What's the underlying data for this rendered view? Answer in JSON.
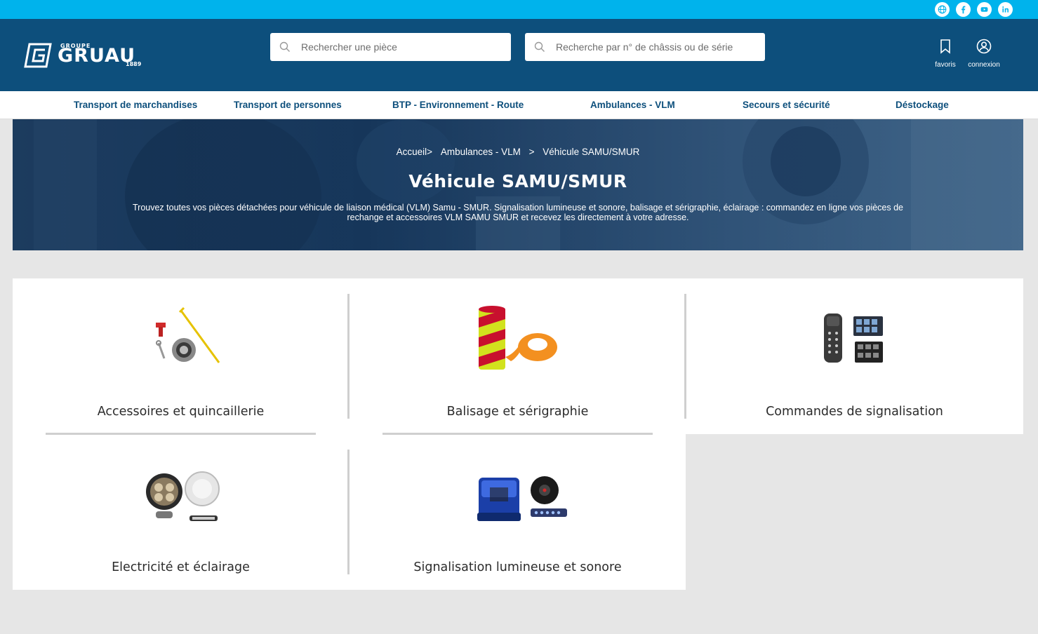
{
  "brand": {
    "small": "GROUPE",
    "name": "GRUAU",
    "year": "1889"
  },
  "colors": {
    "topbar": "#00b3ec",
    "header": "#0d4f7c",
    "nav_text": "#0d4f7c"
  },
  "social": [
    {
      "icon": "globe-icon"
    },
    {
      "icon": "facebook-icon"
    },
    {
      "icon": "youtube-icon"
    },
    {
      "icon": "linkedin-icon"
    }
  ],
  "search": {
    "part_placeholder": "Rechercher une pièce",
    "chassis_placeholder": "Recherche par n° de châssis ou de série"
  },
  "header_actions": {
    "favorites": "favoris",
    "login": "connexion"
  },
  "nav": [
    "Transport de marchandises",
    "Transport de personnes",
    "BTP - Environnement - Route",
    "Ambulances - VLM",
    "Secours et sécurité",
    "Déstockage"
  ],
  "breadcrumb": {
    "home": "Accueil>",
    "category": "Ambulances - VLM",
    "sep": ">",
    "current": "Véhicule SAMU/SMUR"
  },
  "hero": {
    "title": "Véhicule SAMU/SMUR",
    "description": "Trouvez toutes vos pièces détachées pour véhicule de liaison médical (VLM) Samu - SMUR. Signalisation lumineuse et sonore, balisage et sérigraphie, éclairage : commandez en ligne vos pièces de rechange et accessoires VLM SAMU SMUR et recevez les directement à votre adresse."
  },
  "categories": [
    {
      "label": "Accessoires et quincaillerie"
    },
    {
      "label": "Balisage et sérigraphie"
    },
    {
      "label": "Commandes de signalisation"
    },
    {
      "label": "Electricité et éclairage"
    },
    {
      "label": "Signalisation lumineuse et sonore"
    }
  ]
}
